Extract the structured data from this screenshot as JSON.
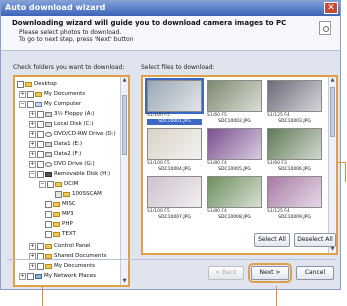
{
  "window": {
    "title": "Auto download wizard",
    "close_glyph": "✕"
  },
  "header": {
    "title": "Downloading wizard will guide you to download camera images to PC",
    "line1": "Please select photos to download.",
    "line2": "To go to next step, press 'Next' button"
  },
  "left": {
    "label": "Check folders you want to download:",
    "tree": [
      {
        "text": "Desktop",
        "icon": "folder-icon"
      },
      {
        "text": "My Documents",
        "icon": "folder-icon"
      },
      {
        "text": "My Computer",
        "icon": "computer-icon"
      },
      {
        "text": "3½ Floppy (A:)",
        "icon": "floppy-icon"
      },
      {
        "text": "Local Disk (C:)",
        "icon": "drive-icon"
      },
      {
        "text": "DVD/CD-RW Drive (D:)",
        "icon": "disc-icon"
      },
      {
        "text": "Data1 (E:)",
        "icon": "drive-icon"
      },
      {
        "text": "Data2 (F:)",
        "icon": "drive-icon"
      },
      {
        "text": "DVD Drive (G:)",
        "icon": "disc-icon"
      },
      {
        "text": "Removable Disk (H:)",
        "icon": "camera-icon"
      },
      {
        "text": "DCIM",
        "icon": "folder-icon"
      },
      {
        "text": "100SSCAM",
        "icon": "folder-icon"
      },
      {
        "text": "MISC",
        "icon": "folder-icon"
      },
      {
        "text": "MP3",
        "icon": "folder-icon"
      },
      {
        "text": "PHP",
        "icon": "folder-icon"
      },
      {
        "text": "TEXT",
        "icon": "folder-icon"
      },
      {
        "text": "Control Panel",
        "icon": "folder-icon"
      },
      {
        "text": "Shared Documents",
        "icon": "folder-icon"
      },
      {
        "text": "My Documents",
        "icon": "folder-icon"
      },
      {
        "text": "My Network Places",
        "icon": "network-icon"
      }
    ]
  },
  "right": {
    "label": "Select files to download:",
    "thumbnails": [
      {
        "info": "S1/100 F5",
        "name": "SDC10001.JPG",
        "color": "#9aa8b4",
        "selected": true
      },
      {
        "info": "S1/60 F5",
        "name": "SDC10002.JPG",
        "color": "#7d8a6e",
        "selected": false
      },
      {
        "info": "S1/125 F4",
        "name": "SDC10003.JPG",
        "color": "#6b6b7a",
        "selected": false
      },
      {
        "info": "S1/100 F5",
        "name": "SDC10004.JPG",
        "color": "#d9d2c7",
        "selected": false
      },
      {
        "info": "S1/80 F4",
        "name": "SDC10005.JPG",
        "color": "#7a4f8f",
        "selected": false
      },
      {
        "info": "S1/60 F3",
        "name": "SDC10006.JPG",
        "color": "#5f7a55",
        "selected": false
      },
      {
        "info": "S1/100 F5",
        "name": "SDC10007.JPG",
        "color": "#cfc2cf",
        "selected": false
      },
      {
        "info": "S1/80 F4",
        "name": "SDC10008.JPG",
        "color": "#6f8f5f",
        "selected": false
      },
      {
        "info": "S1/125 F4",
        "name": "SDC10009.JPG",
        "color": "#a77aa6",
        "selected": false
      }
    ],
    "select_all": "Select All",
    "deselect_all": "Deselect All"
  },
  "footer": {
    "back": "< Back",
    "next": "Next >",
    "cancel": "Cancel"
  }
}
